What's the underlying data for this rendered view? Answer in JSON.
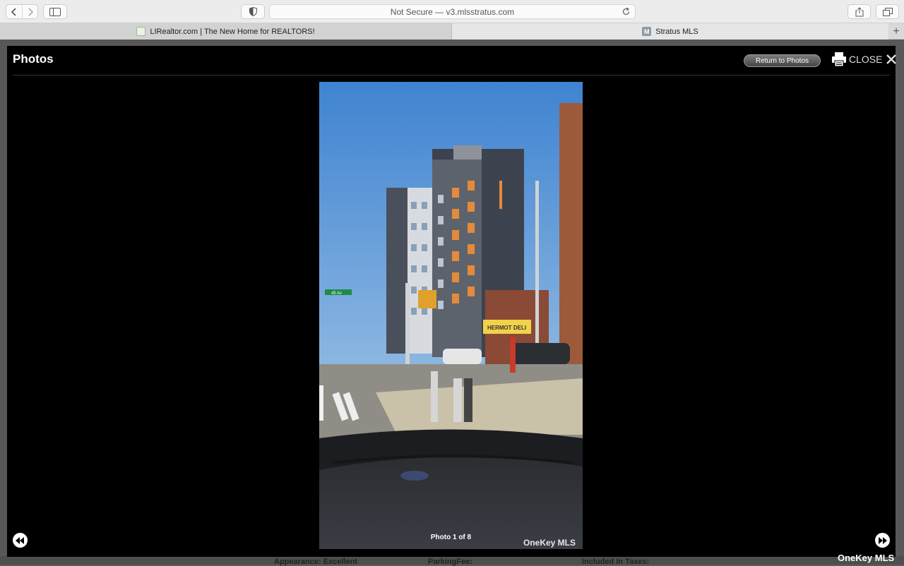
{
  "browser": {
    "address": "Not Secure — v3.mlsstratus.com",
    "tabs": [
      {
        "title": "LIRealtor.com | The New Home for REALTORS!",
        "favicon": "lirealtor-favicon"
      },
      {
        "title": "Stratus MLS",
        "favicon": "M"
      }
    ],
    "new_tab": "+"
  },
  "modal": {
    "title": "Photos",
    "return_label": "Return to Photos",
    "close_label": "CLOSE",
    "photo_caption": "Photo 1 of 8",
    "photo_watermark": "OneKey MLS",
    "street_sign": "45 Av",
    "store_sign": "HERMOT DELI"
  },
  "page_behind": {
    "labels": [
      "Appearance: Excellent",
      "ParkingFee:",
      "Included In Taxes:"
    ]
  },
  "brand_watermark": "OneKey MLS",
  "icons": {
    "back": "chevron-left-icon",
    "forward": "chevron-right-icon",
    "sidebar": "sidebar-icon",
    "privacy": "shield-icon",
    "reload": "reload-icon",
    "share": "share-icon",
    "tabs": "tabs-overview-icon",
    "print": "printer-icon",
    "close": "close-icon",
    "prev": "rewind-icon",
    "next": "fast-forward-icon"
  },
  "colors": {
    "modal_bg": "#000000",
    "sky": "#4d8fd6",
    "building_dark": "#3d434e",
    "accent_orange": "#e58a3c"
  }
}
